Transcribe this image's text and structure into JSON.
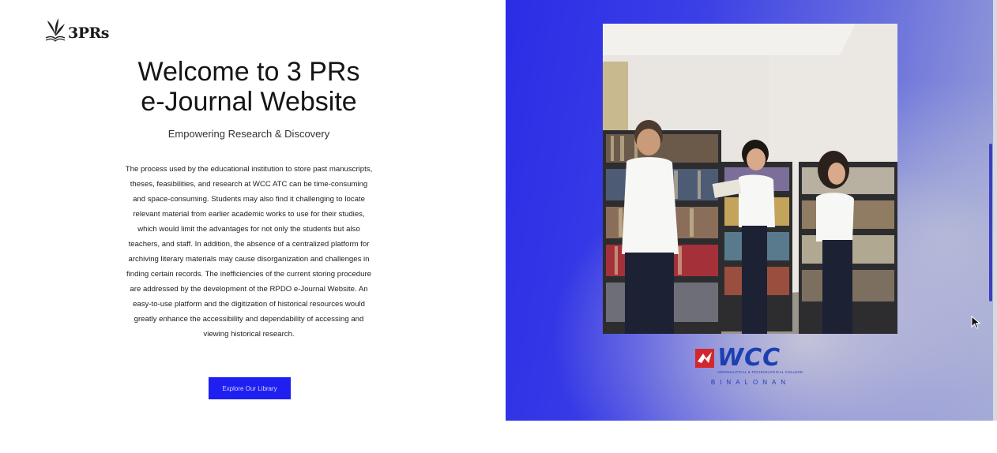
{
  "brand": {
    "logo_text": "3PRs",
    "logo_icon": "open-book-leaves-icon"
  },
  "hero": {
    "title": "Welcome to 3 PRs\ne-Journal Website",
    "subtitle": "Empowering Research & Discovery",
    "description": "The process used by the educational institution to store past manuscripts, theses, feasibilities, and research at WCC ATC can be time-consuming and space-consuming. Students may also find it challenging to locate relevant material from earlier academic works to use for their studies, which would limit the advantages for not only the students but also teachers, and staff. In addition, the absence of a centralized platform for archiving literary materials may cause disorganization and challenges in finding certain records. The inefficiencies of the current storing procedure are addressed by the development of the RPDO e-Journal Website. An easy-to-use platform and the digitization of historical resources would greatly enhance the accessibility and dependability of accessing and viewing historical research.",
    "cta_label": "Explore Our Library"
  },
  "partner": {
    "name": "WCC",
    "tagline": "AERONAUTICAL & TECHNOLOGICAL COLLEGE",
    "campus": "BINALONAN"
  },
  "colors": {
    "accent": "#1f1ff2",
    "panel_blue": "#2b2de6",
    "wcc_blue": "#1d3fb0"
  }
}
